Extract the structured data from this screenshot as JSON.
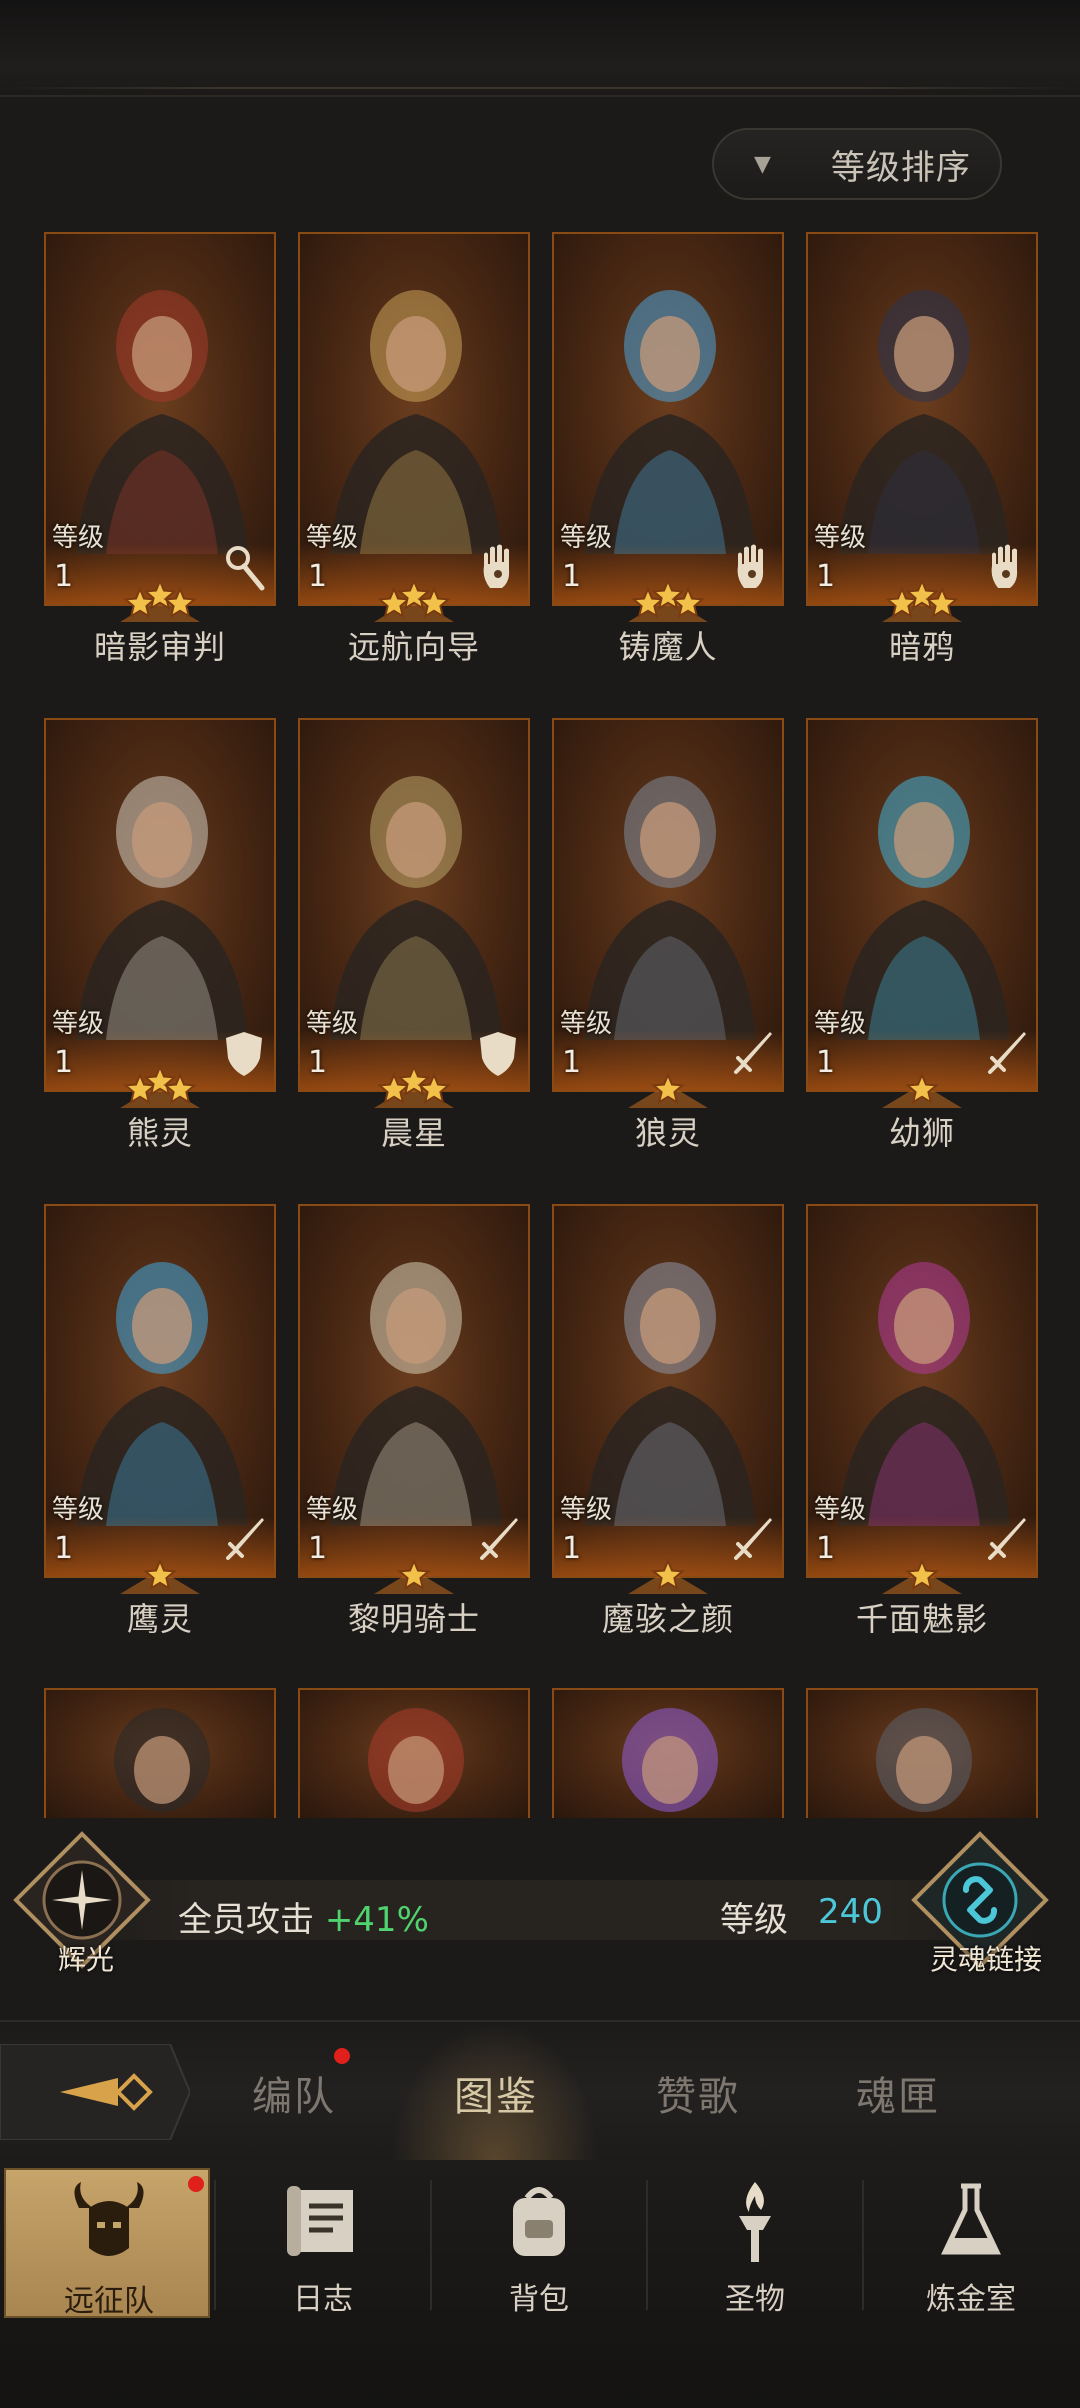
{
  "sort_button": {
    "label": "等级排序"
  },
  "heroes": [
    {
      "name": "暗影审判",
      "level_label": "等级",
      "level": "1",
      "stars": 3,
      "class_icon": "magnifier-staff-icon",
      "tint": "#a33a2a"
    },
    {
      "name": "远航向导",
      "level_label": "等级",
      "level": "1",
      "stars": 3,
      "class_icon": "hand-icon",
      "tint": "#c9a25a"
    },
    {
      "name": "铸魔人",
      "level_label": "等级",
      "level": "1",
      "stars": 3,
      "class_icon": "hand-icon",
      "tint": "#4aa3d8"
    },
    {
      "name": "暗鸦",
      "level_label": "等级",
      "level": "1",
      "stars": 3,
      "class_icon": "hand-icon",
      "tint": "#2c3550"
    },
    {
      "name": "熊灵",
      "level_label": "等级",
      "level": "1",
      "stars": 3,
      "class_icon": "shield-icon",
      "tint": "#cfcac0"
    },
    {
      "name": "晨星",
      "level_label": "等级",
      "level": "1",
      "stars": 3,
      "class_icon": "shield-icon",
      "tint": "#b8a46a"
    },
    {
      "name": "狼灵",
      "level_label": "等级",
      "level": "1",
      "stars": 1,
      "class_icon": "sword-icon",
      "tint": "#7d8a9a"
    },
    {
      "name": "幼狮",
      "level_label": "等级",
      "level": "1",
      "stars": 1,
      "class_icon": "sword-icon",
      "tint": "#3fb3d8"
    },
    {
      "name": "鹰灵",
      "level_label": "等级",
      "level": "1",
      "stars": 1,
      "class_icon": "sword-icon",
      "tint": "#3fa7e0"
    },
    {
      "name": "黎明骑士",
      "level_label": "等级",
      "level": "1",
      "stars": 1,
      "class_icon": "sword-icon",
      "tint": "#d6cdb8"
    },
    {
      "name": "魔骇之颜",
      "level_label": "等级",
      "level": "1",
      "stars": 1,
      "class_icon": "sword-icon",
      "tint": "#8c96a8"
    },
    {
      "name": "千面魅影",
      "level_label": "等级",
      "level": "1",
      "stars": 1,
      "class_icon": "sword-icon",
      "tint": "#b23a9a"
    }
  ],
  "partial_heroes": [
    {
      "tint": "#2a2a2a"
    },
    {
      "tint": "#a33a2a"
    },
    {
      "tint": "#8a5ac8"
    },
    {
      "tint": "#5a5e66"
    }
  ],
  "stats": {
    "left_emblem_label": "辉光",
    "attack_label": "全员攻击",
    "attack_value": "+41%",
    "level_label": "等级",
    "level_value": "240",
    "right_emblem_label": "灵魂链接"
  },
  "tabs": [
    {
      "label": "编队",
      "active": false,
      "badge": true
    },
    {
      "label": "图鉴",
      "active": true,
      "badge": false
    },
    {
      "label": "赞歌",
      "active": false,
      "badge": false
    },
    {
      "label": "魂匣",
      "active": false,
      "badge": false
    }
  ],
  "nav": [
    {
      "label": "远征队",
      "icon": "horned-helmet-icon",
      "active": true,
      "badge": true
    },
    {
      "label": "日志",
      "icon": "scroll-icon",
      "active": false,
      "badge": false
    },
    {
      "label": "背包",
      "icon": "backpack-icon",
      "active": false,
      "badge": false
    },
    {
      "label": "圣物",
      "icon": "torch-icon",
      "active": false,
      "badge": false
    },
    {
      "label": "炼金室",
      "icon": "alchemy-icon",
      "active": false,
      "badge": false
    }
  ],
  "colors": {
    "accent_gold": "#c6a46a",
    "level_cyan": "#4cc7d8",
    "buff_green": "#4fd36e",
    "badge_red": "#e0201a"
  }
}
